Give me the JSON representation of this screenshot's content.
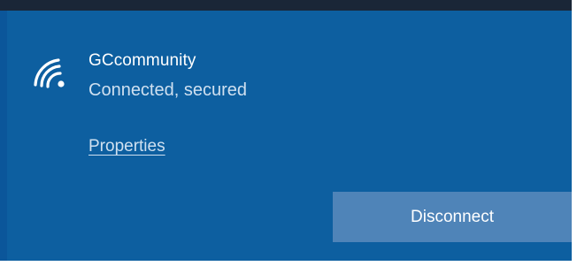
{
  "network": {
    "name": "GCcommunity",
    "status": "Connected, secured",
    "icon": "wifi-secured-icon"
  },
  "links": {
    "properties_label": "Properties"
  },
  "actions": {
    "disconnect_label": "Disconnect"
  },
  "colors": {
    "panel_bg": "#0d5fa0",
    "top_strip": "#1a2637",
    "button_bg": "#4f84b8",
    "primary_text": "#ffffff",
    "secondary_text": "#cfe0f0"
  }
}
